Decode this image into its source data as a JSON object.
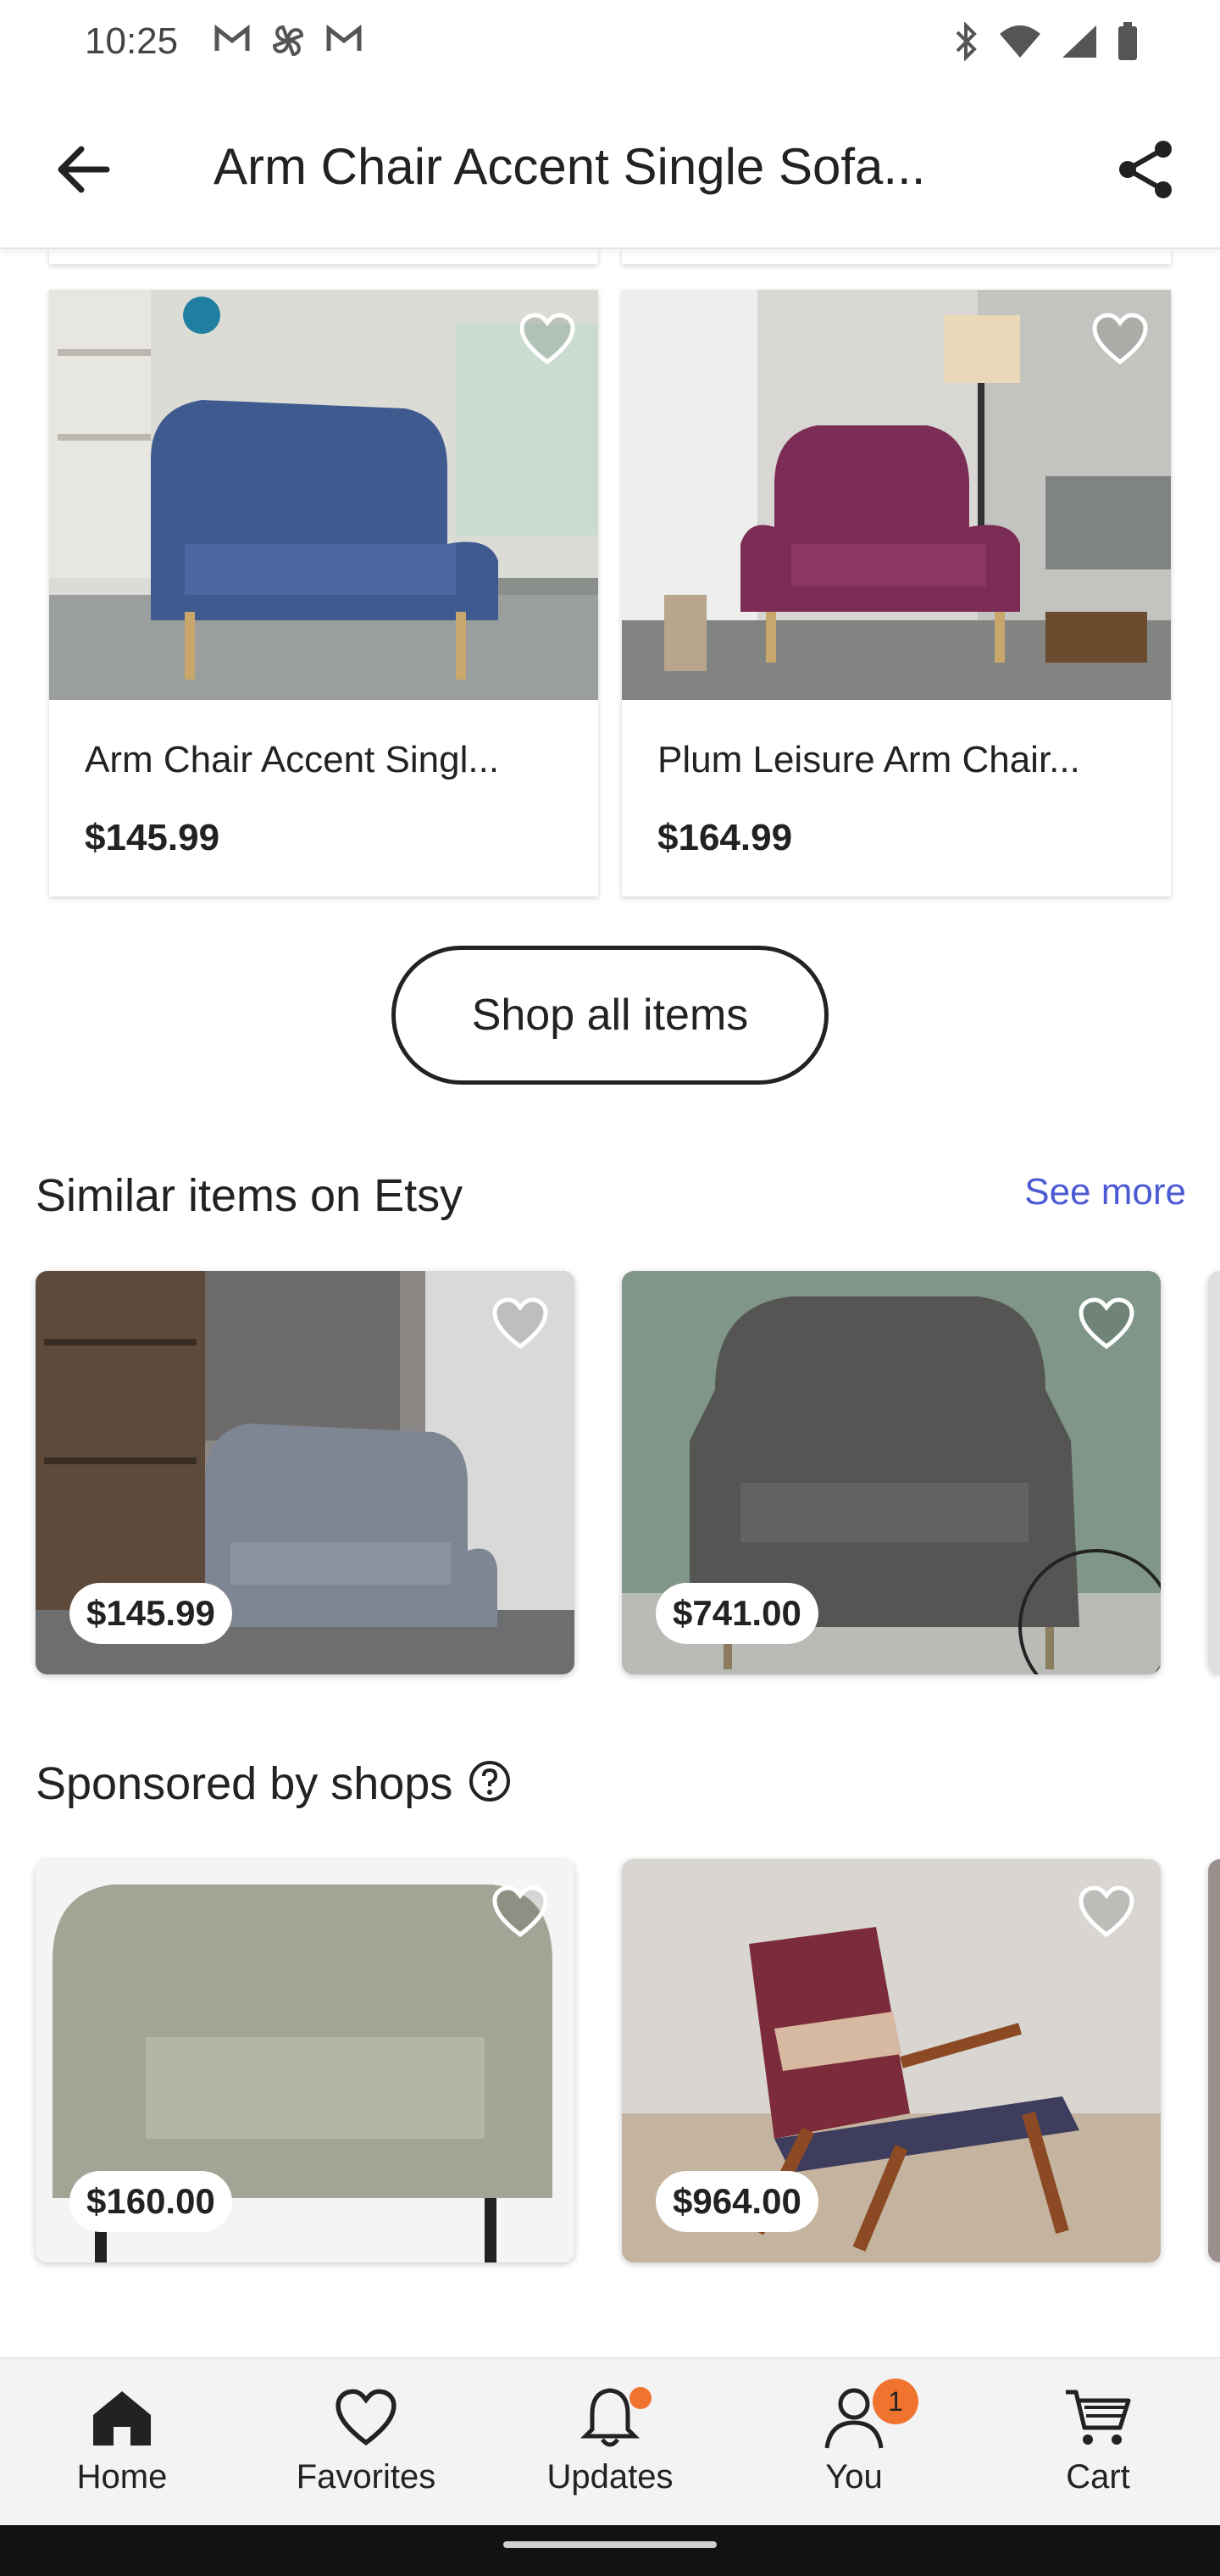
{
  "status_bar": {
    "time": "10:25",
    "left_icons": [
      "gmail-icon",
      "pinwheel-icon",
      "gmail-icon"
    ],
    "right_icons": [
      "bluetooth-icon",
      "wifi-icon",
      "signal-icon",
      "battery-icon"
    ]
  },
  "header": {
    "title": "Arm Chair Accent Single Sofa..."
  },
  "shop_items": [
    {
      "title": "Arm Chair Accent Singl...",
      "price": "$145.99",
      "color": "#3e5a8f"
    },
    {
      "title": "Plum Leisure Arm Chair...",
      "price": "$164.99",
      "color": "#7b2d55"
    }
  ],
  "shop_all_label": "Shop all items",
  "similar": {
    "heading": "Similar items on Etsy",
    "see_more": "See more",
    "items": [
      {
        "price": "$145.99"
      },
      {
        "price": "$741.00"
      }
    ]
  },
  "sponsored": {
    "heading": "Sponsored by shops",
    "items": [
      {
        "price": "$160.00"
      },
      {
        "price": "$964.00"
      }
    ]
  },
  "bottom_nav": {
    "items": [
      {
        "label": "Home",
        "icon": "home-icon"
      },
      {
        "label": "Favorites",
        "icon": "heart-icon"
      },
      {
        "label": "Updates",
        "icon": "bell-icon"
      },
      {
        "label": "You",
        "icon": "person-icon",
        "badge": "1"
      },
      {
        "label": "Cart",
        "icon": "cart-icon"
      }
    ]
  },
  "colors": {
    "accent_link": "#4d5bd3",
    "badge": "#f0742f"
  }
}
